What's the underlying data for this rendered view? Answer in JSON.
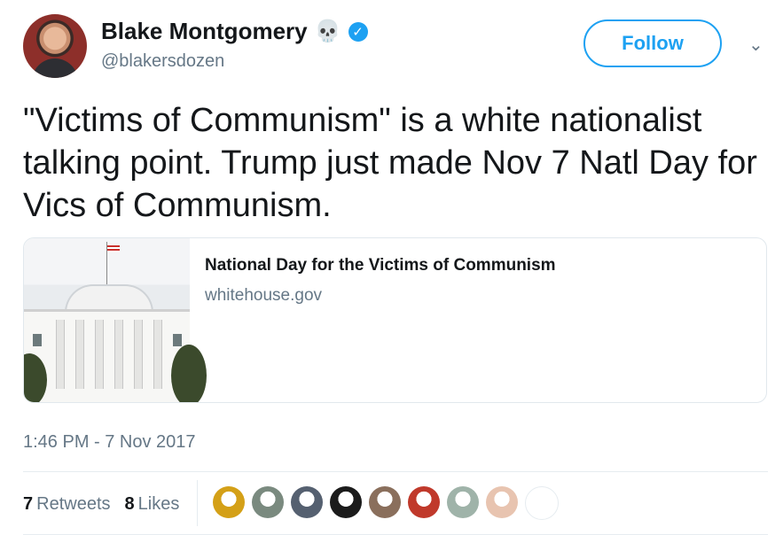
{
  "user": {
    "name": "Blake Montgomery",
    "name_emoji": "💀",
    "verified_glyph": "✓",
    "handle": "@blakersdozen"
  },
  "actions": {
    "follow_label": "Follow",
    "caret_glyph": "⌄"
  },
  "tweet": {
    "text": "\"Victims of Communism\" is a white nationalist talking point. Trump just made Nov 7 Natl Day for Vics of Communism."
  },
  "card": {
    "title": "National Day for the Victims of Communism",
    "domain": "whitehouse.gov"
  },
  "meta": {
    "timestamp": "1:46 PM - 7 Nov 2017"
  },
  "stats": {
    "retweets_count": "7",
    "retweets_label": "Retweets",
    "likes_count": "8",
    "likes_label": "Likes"
  },
  "likers": [
    {
      "color": "#d4a017"
    },
    {
      "color": "#7a8a7f"
    },
    {
      "color": "#556070"
    },
    {
      "color": "#1b1b1b"
    },
    {
      "color": "#8a6f5c"
    },
    {
      "color": "#c0392b"
    },
    {
      "color": "#9fb3a9"
    },
    {
      "color": "#e8c4b0"
    },
    {
      "color": "#ffffff"
    }
  ],
  "colors": {
    "accent": "#1da1f2",
    "muted": "#657786",
    "text": "#14171a"
  }
}
